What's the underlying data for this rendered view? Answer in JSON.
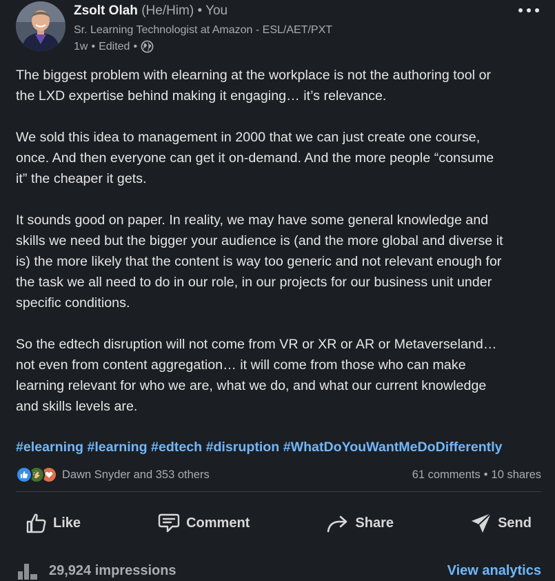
{
  "author": {
    "name": "Zsolt Olah",
    "pronouns": "(He/Him)",
    "relation": "You",
    "headline": "Sr. Learning Technologist at Amazon - ESL/AET/PXT",
    "age": "1w",
    "edited": "Edited",
    "visibility_icon": "globe-icon"
  },
  "post": {
    "paragraphs": [
      "The biggest problem with elearning at the workplace is not the authoring tool or\nthe LXD expertise behind making it engaging… it’s relevance.",
      "We sold this idea to management in 2000 that we can just create one course,\nonce. And then everyone can get it on-demand. And the more people “consume\nit” the cheaper it gets.",
      "It sounds good on paper. In reality, we may have some general knowledge and\nskills we need but the bigger your audience is (and the more global and diverse it\nis) the more likely that the content is way too generic and not relevant enough for\nthe task we all need to do in our role, in our projects for our business unit under\nspecific conditions.",
      "So the edtech disruption will not come from VR or XR or AR or Metaverseland…\nnot even from content aggregation… it will come from those who can make\nlearning relevant for who we are, what we do, and what our current knowledge\nand skills levels are."
    ],
    "hashtags": [
      "#elearning",
      "#learning",
      "#edtech",
      "#disruption",
      "#WhatDoYouWantMeDoDifferently"
    ]
  },
  "social": {
    "reactions": [
      "like-icon",
      "celebrate-icon",
      "love-icon"
    ],
    "reactors_text": "Dawn Snyder and 353 others",
    "comments": "61 comments",
    "separator": "•",
    "shares": "10 shares"
  },
  "actions": {
    "like": "Like",
    "comment": "Comment",
    "share": "Share",
    "send": "Send"
  },
  "footer": {
    "impressions": "29,924 impressions",
    "analytics": "View analytics"
  },
  "colors": {
    "background": "#1b1f23",
    "link": "#71b7fb",
    "muted": "#a9adb2"
  }
}
